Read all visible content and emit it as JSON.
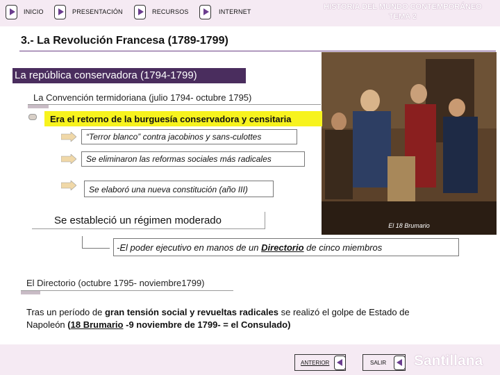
{
  "nav": {
    "inicio": "INICIO",
    "presentacion": "PRESENTACIÓN",
    "recursos": "RECURSOS",
    "internet": "INTERNET"
  },
  "header": {
    "line1": "HISTORIA DEL MUNDO CONTEMPORÁNEO",
    "line2": "TEMA 2"
  },
  "section_title": "3.- La Revolución Francesa (1789-1799)",
  "band_title": "La república conservadora (1794-1799)",
  "sub1": "La Convención termidoriana (julio 1794- octubre 1795)",
  "highlight": "Era el retorno de la burguesía conservadora y censitaria",
  "points": [
    "“Terror blanco” contra jacobinos y sans-culottes",
    "Se eliminaron las reformas sociales más radicales",
    "Se elaboró una nueva constitución (año III)"
  ],
  "moderate": "Se estableció un régimen moderado",
  "directorio": {
    "before": "-El poder ejecutivo en manos de un ",
    "bold": "Directorio",
    "after": " de cinco miembros"
  },
  "painting_caption": "El 18 Brumario",
  "sub2": "El Directorio (octubre 1795- noviembre1799)",
  "paragraph": {
    "t1": "Tras un período de ",
    "b1": "gran tensión social y revueltas radicales",
    "t2": " se realizó el golpe de Estado de Napoleón ",
    "b2a": "(",
    "b2u": "18 Brumario",
    "b2b": " -9 noviembre de 1799- = el Consulado)"
  },
  "footer": {
    "anterior": "ANTERIOR",
    "salir": "SALIR",
    "brand": "Santillana"
  },
  "colors": {
    "accent": "#4a2d5e",
    "highlight": "#f7f31e",
    "bar_bg": "#f5eaf3",
    "arrow": "#f0d8a8"
  }
}
